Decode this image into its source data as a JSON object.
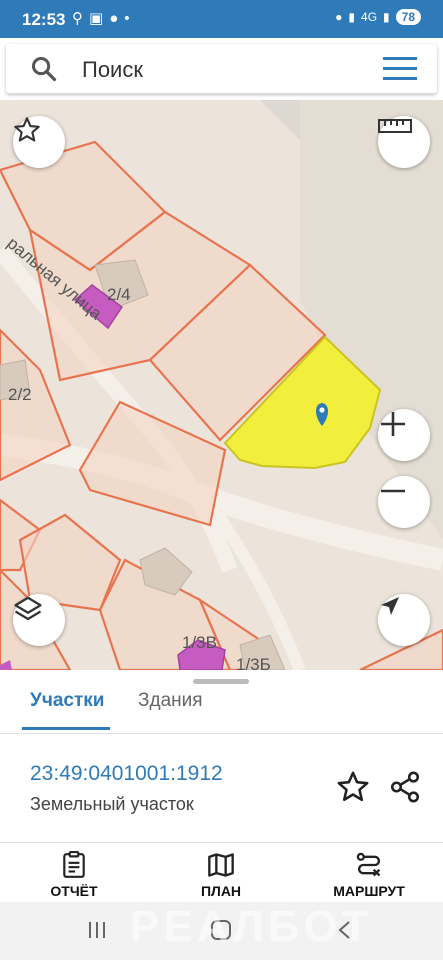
{
  "status_bar": {
    "time": "12:53",
    "network": "4G",
    "battery": "78"
  },
  "search": {
    "placeholder": "Поиск"
  },
  "map": {
    "labels": {
      "street": "ральная улица",
      "parcel_1": "2/4",
      "parcel_2": "2/2",
      "parcel_3": "1/3В",
      "parcel_4": "1/3Б"
    },
    "colors": {
      "parcel_border": "#e8744f",
      "parcel_fill": "#f5d4c4",
      "building": "#c65bc1",
      "selected": "#f2ee3c"
    }
  },
  "sheet": {
    "tabs": [
      "Участки",
      "Здания"
    ],
    "active_tab": "Участки",
    "cadastral_number": "23:49:0401001:1912",
    "type": "Земельный участок"
  },
  "bottom_bar": {
    "report": "ОТЧЁТ",
    "plan": "ПЛАН",
    "route": "МАРШРУТ"
  },
  "watermark": "РЕАЛБОТ"
}
